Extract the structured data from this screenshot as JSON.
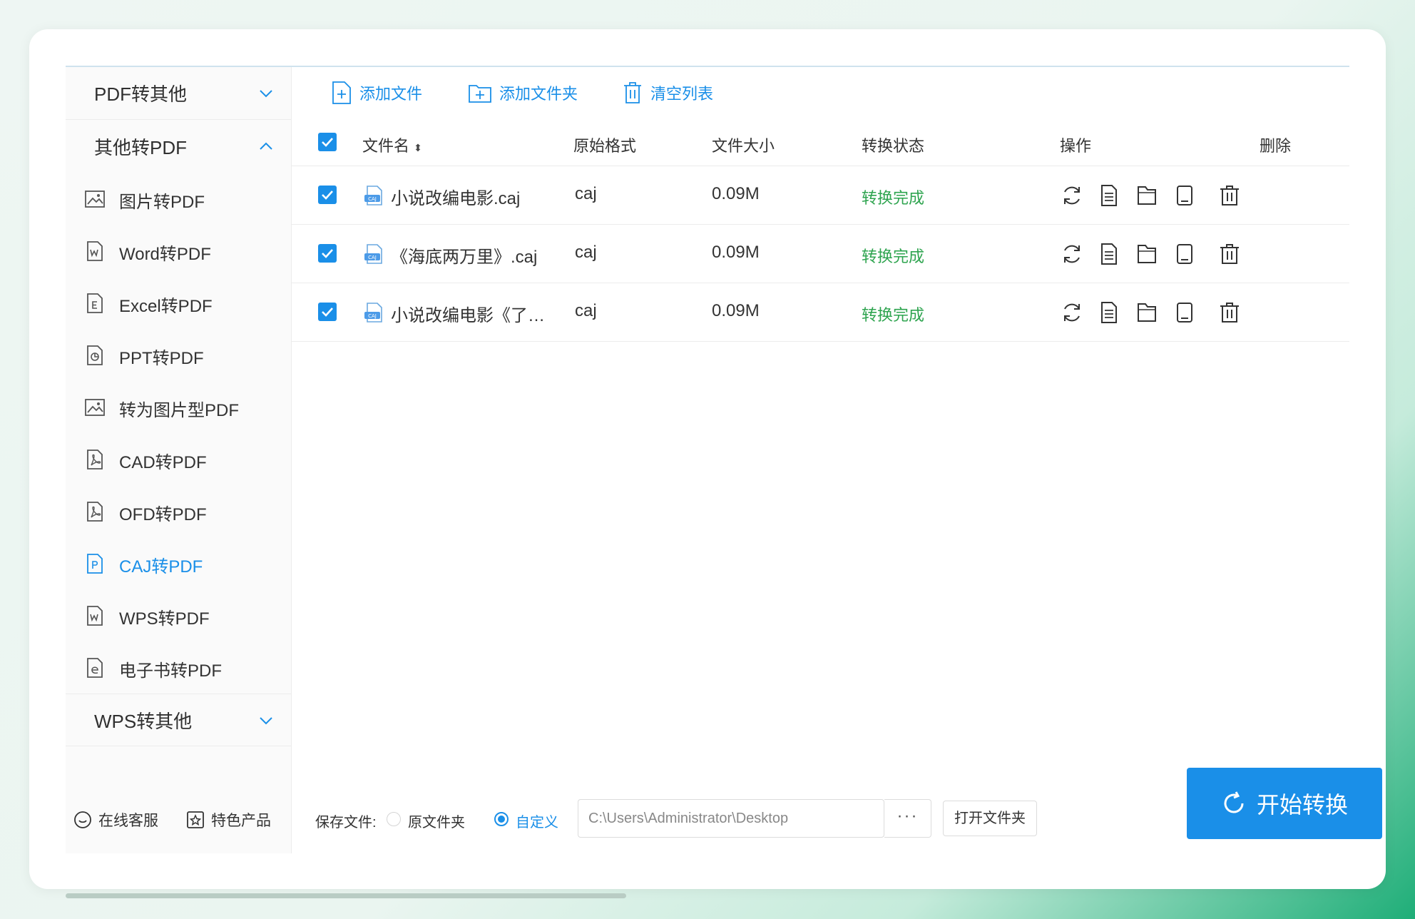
{
  "sidebar": {
    "groups": [
      {
        "label": "PDF转其他",
        "expanded": false
      },
      {
        "label": "其他转PDF",
        "expanded": true
      },
      {
        "label": "WPS转其他",
        "expanded": false
      }
    ],
    "items": [
      {
        "label": "图片转PDF",
        "icon": "image-icon"
      },
      {
        "label": "Word转PDF",
        "icon": "word-file-icon"
      },
      {
        "label": "Excel转PDF",
        "icon": "excel-file-icon"
      },
      {
        "label": "PPT转PDF",
        "icon": "ppt-file-icon"
      },
      {
        "label": "转为图片型PDF",
        "icon": "image-icon"
      },
      {
        "label": "CAD转PDF",
        "icon": "pdf-file-icon"
      },
      {
        "label": "OFD转PDF",
        "icon": "pdf-file-icon"
      },
      {
        "label": "CAJ转PDF",
        "icon": "caj-file-icon",
        "active": true
      },
      {
        "label": "WPS转PDF",
        "icon": "wps-file-icon"
      },
      {
        "label": "电子书转PDF",
        "icon": "ebook-file-icon"
      }
    ],
    "footer": {
      "support": "在线客服",
      "featured": "特色产品"
    }
  },
  "toolbar": {
    "add_file": "添加文件",
    "add_folder": "添加文件夹",
    "clear_list": "清空列表"
  },
  "table": {
    "headers": {
      "name": "文件名",
      "format": "原始格式",
      "size": "文件大小",
      "status": "转换状态",
      "ops": "操作",
      "delete": "删除"
    },
    "rows": [
      {
        "name": "小说改编电影.caj",
        "format": "caj",
        "size": "0.09M",
        "status": "转换完成",
        "checked": true
      },
      {
        "name": "《海底两万里》.caj",
        "format": "caj",
        "size": "0.09M",
        "status": "转换完成",
        "checked": true
      },
      {
        "name": "小说改编电影《了不...",
        "format": "caj",
        "size": "0.09M",
        "status": "转换完成",
        "checked": true
      }
    ]
  },
  "bottom": {
    "save_label": "保存文件:",
    "option_original": "原文件夹",
    "option_custom": "自定义",
    "selected_option": "自定义",
    "path": "C:\\Users\\Administrator\\Desktop",
    "browse_label": "···",
    "open_folder": "打开文件夹",
    "start": "开始转换"
  },
  "colors": {
    "accent": "#1a8fe8",
    "success": "#2ea44f"
  }
}
